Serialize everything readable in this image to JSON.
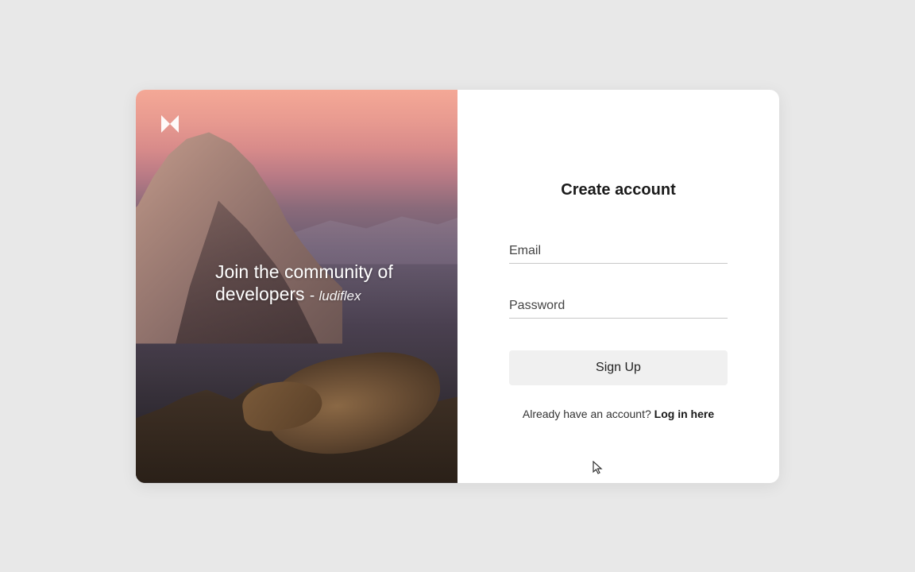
{
  "left": {
    "logo_name": "brand-logo",
    "tagline_main": "Join the community of developers",
    "tagline_dash": " - ",
    "tagline_credit": "ludiflex"
  },
  "form": {
    "title": "Create account",
    "email_placeholder": "Email",
    "password_placeholder": "Password",
    "submit_label": "Sign Up",
    "prompt_text": "Already have an account? ",
    "login_link_text": "Log in here"
  },
  "colors": {
    "page_bg": "#e8e8e8",
    "card_bg": "#ffffff",
    "button_bg": "#f0f0f0",
    "input_border": "#c8c8c8"
  }
}
